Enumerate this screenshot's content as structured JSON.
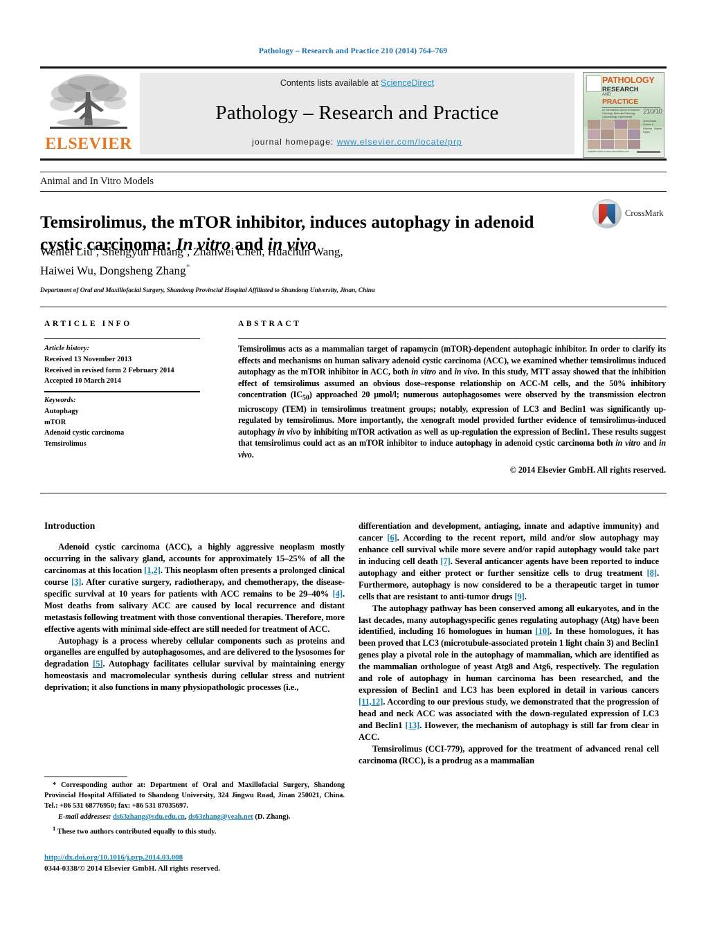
{
  "running_head": "Pathology – Research and Practice 210 (2014) 764–769",
  "masthead": {
    "publisher_logo_name": "ELSEVIER",
    "contents_prefix": "Contents lists available at ",
    "contents_link": "ScienceDirect",
    "journal_title": "Pathology – Research and Practice",
    "homepage_prefix": "journal homepage:",
    "homepage_url": "www.elsevier.com/locate/prp",
    "cover": {
      "line1": "PATHOLOGY",
      "line2": "RESEARCH",
      "line2b": "AND",
      "line3": "PRACTICE",
      "volume": "210/10",
      "meta": "An International Journal of Anatomic Pathology, Molecular Pathology, Cytopathology, Experimental Pathology and Laboratory Medicine",
      "side": "Guest Editors · Reviews & Editorials · Original Papers",
      "foot": "Available online at www.sciencedirect.com"
    }
  },
  "section_label": "Animal and In Vitro Models",
  "title_part1": "Temsirolimus, the mTOR inhibitor, induces autophagy in adenoid cystic carcinoma: ",
  "title_italic1": "In vitro",
  "title_mid": " and ",
  "title_italic2": "in vivo",
  "crossmark_label": "CrossMark",
  "authors_line1_a": "Wenlei Liu",
  "authors_line1_sup1": "1",
  "authors_line1_b": ", Shengyun Huang",
  "authors_line1_sup2": "1",
  "authors_line1_c": ", Zhanwei Chen, Huachun Wang,",
  "authors_line2": "Haiwei Wu, Dongsheng Zhang",
  "authors_star": "*",
  "affiliation": "Department of Oral and Maxillofacial Surgery, Shandong Provincial Hospital Affiliated to Shandong University, Jinan, China",
  "article_info": {
    "heading": "ARTICLE INFO",
    "history_label": "Article history:",
    "history": [
      "Received 13 November 2013",
      "Received in revised form 2 February 2014",
      "Accepted 10 March 2014"
    ],
    "keywords_label": "Keywords:",
    "keywords": [
      "Autophagy",
      "mTOR",
      "Adenoid cystic carcinoma",
      "Temsirolimus"
    ]
  },
  "abstract": {
    "heading": "ABSTRACT",
    "p1_a": "Temsirolimus acts as a mammalian target of rapamycin (mTOR)-dependent autophagic inhibitor. In order to clarify its effects and mechanisms on human salivary adenoid cystic carcinoma (ACC), we examined whether temsirolimus induced autophagy as the mTOR inhibitor in ACC, both ",
    "p1_i1": "in vitro",
    "p1_b": " and ",
    "p1_i2": "in vivo",
    "p1_c": ". In this study, MTT assay showed that the inhibition effect of temsirolimus assumed an obvious dose–response relationship on ACC-M cells, and the 50% inhibitory concentration (IC",
    "p1_sub": "50",
    "p1_d": ") approached 20 μmol/l; numerous autophagosomes were observed by the transmission electron microscopy (TEM) in temsirolimus treatment groups; notably, expression of LC3 and Beclin1 was significantly up-regulated by temsirolimus. More importantly, the xenograft model provided further evidence of temsirolimus-induced autophagy ",
    "p1_i3": "in vivo",
    "p1_e": " by inhibiting mTOR activation as well as up-regulation the expression of Beclin1. These results suggest that temsirolimus could act as an mTOR inhibitor to induce autophagy in adenoid cystic carcinoma both ",
    "p1_i4": "in vitro",
    "p1_f": " and ",
    "p1_i5": "in vivo",
    "p1_g": ".",
    "copyright": "© 2014 Elsevier GmbH. All rights reserved."
  },
  "body": {
    "intro_heading": "Introduction",
    "left": {
      "p1_a": "Adenoid cystic carcinoma (ACC), a highly aggressive neoplasm mostly occurring in the salivary gland, accounts for approximately 15–25% of all the carcinomas at this location ",
      "p1_r1": "[1,2]",
      "p1_b": ". This neoplasm often presents a prolonged clinical course ",
      "p1_r2": "[3]",
      "p1_c": ". After curative surgery, radiotherapy, and chemotherapy, the disease-specific survival at 10 years for patients with ACC remains to be 29–40% ",
      "p1_r3": "[4]",
      "p1_d": ". Most deaths from salivary ACC are caused by local recurrence and distant metastasis following treatment with those conventional therapies. Therefore, more effective agents with minimal side-effect are still needed for treatment of ACC.",
      "p2_a": "Autophagy is a process whereby cellular components such as proteins and organelles are engulfed by autophagosomes, and are delivered to the lysosomes for degradation ",
      "p2_r1": "[5]",
      "p2_b": ". Autophagy facilitates cellular survival by maintaining energy homeostasis and macromolecular synthesis during cellular stress and nutrient deprivation; it also functions in many physiopathologic processes (i.e.,"
    },
    "right": {
      "p1_a": "differentiation and development, antiaging, innate and adaptive immunity) and cancer ",
      "p1_r1": "[6]",
      "p1_b": ". According to the recent report, mild and/or slow autophagy may enhance cell survival while more severe and/or rapid autophagy would take part in inducing cell death ",
      "p1_r2": "[7]",
      "p1_c": ". Several anticancer agents have been reported to induce autophagy and either protect or further sensitize cells to drug treatment ",
      "p1_r3": "[8]",
      "p1_d": ". Furthermore, autophagy is now considered to be a therapeutic target in tumor cells that are resistant to anti-tumor drugs ",
      "p1_r4": "[9]",
      "p1_e": ".",
      "p2_a": "The autophagy pathway has been conserved among all eukaryotes, and in the last decades, many autophagyspecific genes regulating autophagy (Atg) have been identified, including 16 homologues in human ",
      "p2_r1": "[10]",
      "p2_b": ". In these homologues, it has been proved that LC3 (microtubule-associated protein 1 light chain 3) and Beclin1 genes play a pivotal role in the autophagy of mammalian, which are identified as the mammalian orthologue of yeast Atg8 and Atg6, respectively. The regulation and role of autophagy in human carcinoma has been researched, and the expression of Beclin1 and LC3 has been explored in detail in various cancers ",
      "p2_r2": "[11,12]",
      "p2_c": ". According to our previous study, we demonstrated that the progression of head and neck ACC was associated with the down-regulated expression of LC3 and Beclin1 ",
      "p2_r3": "[13]",
      "p2_d": ". However, the mechanism of autophagy is still far from clear in ACC.",
      "p3": "Temsirolimus (CCI-779), approved for the treatment of advanced renal cell carcinoma (RCC), is a prodrug as a mammalian"
    }
  },
  "footnotes": {
    "star": "*",
    "corresponding": " Corresponding author at: Department of Oral and Maxillofacial Surgery, Shandong Provincial Hospital Affiliated to Shandong University, 324 Jingwu Road, Jinan 250021, China. Tel.: +86 531 68776950; fax: +86 531 87035697.",
    "email_label": "E-mail addresses:",
    "email1": "ds63zhang@sdu.edu.cn",
    "email_sep": ", ",
    "email2": "ds63zhang@yeah.net",
    "email_suffix": " (D. Zhang).",
    "equal_sup": "1",
    "equal": " These two authors contributed equally to this study.",
    "doi": "http://dx.doi.org/10.1016/j.prp.2014.03.008",
    "issn": "0344-0338/© 2014 Elsevier GmbH. All rights reserved."
  }
}
